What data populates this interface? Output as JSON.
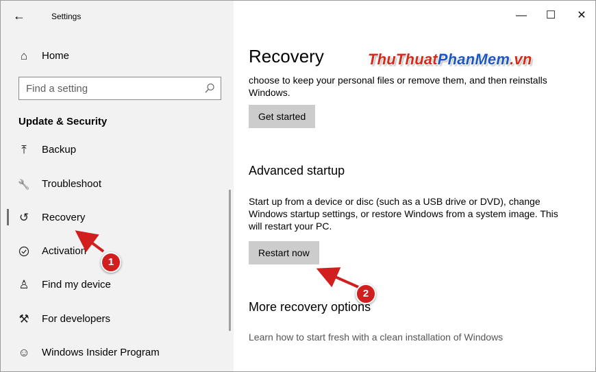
{
  "window": {
    "title": "Settings",
    "back_glyph": "←",
    "minimize_glyph": "—",
    "maximize_glyph": "☐",
    "close_glyph": "✕"
  },
  "sidebar": {
    "home": {
      "label": "Home",
      "icon": "home-icon",
      "glyph": "⌂"
    },
    "search": {
      "placeholder": "Find a setting",
      "icon": "search-icon"
    },
    "section": "Update & Security",
    "items": [
      {
        "label": "Backup",
        "icon": "backup-icon",
        "glyph": "⤒"
      },
      {
        "label": "Troubleshoot",
        "icon": "wrench-icon",
        "glyph": "🔧"
      },
      {
        "label": "Recovery",
        "icon": "recovery-icon",
        "glyph": "↺",
        "selected": true
      },
      {
        "label": "Activation",
        "icon": "check-circle-icon",
        "glyph": "✓"
      },
      {
        "label": "Find my device",
        "icon": "person-pin-icon",
        "glyph": "♙"
      },
      {
        "label": "For developers",
        "icon": "developer-tools-icon",
        "glyph": "⚒"
      },
      {
        "label": "Windows Insider Program",
        "icon": "insider-icon",
        "glyph": "☺"
      }
    ]
  },
  "main": {
    "title": "Recovery",
    "watermark": {
      "part1": "ThuThuat",
      "part2": "PhanMem",
      "part3": ".vn"
    },
    "reset_text": "choose to keep your personal files or remove them, and then reinstalls Windows.",
    "get_started_label": "Get started",
    "advanced_heading": "Advanced startup",
    "advanced_text": "Start up from a device or disc (such as a USB drive or DVD), change Windows startup settings, or restore Windows from a system image. This will restart your PC.",
    "restart_label": "Restart now",
    "more_heading": "More recovery options",
    "more_link": "Learn how to start fresh with a clean installation of Windows"
  },
  "annotations": {
    "marker_1": "1",
    "marker_2": "2",
    "color": "#d11f1f"
  }
}
